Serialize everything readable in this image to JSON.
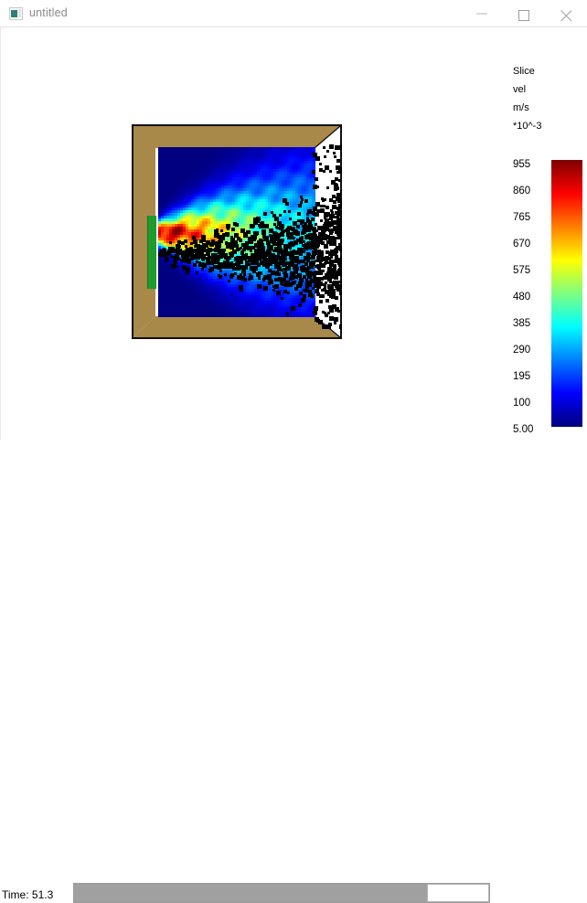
{
  "window": {
    "title": "untitled",
    "icon": "app-icon",
    "controls": {
      "minimize": "minimize",
      "maximize": "maximize",
      "close": "close"
    }
  },
  "legend": {
    "lines": [
      "Slice",
      "vel",
      "m/s",
      "*10^-3"
    ],
    "ticks": [
      "955",
      "860",
      "765",
      "670",
      "575",
      "480",
      "385",
      "290",
      "195",
      "100",
      "5.00"
    ],
    "colormap": "jet",
    "colors": [
      "#ff0000",
      "#ff7f00",
      "#ffff00",
      "#00ff00",
      "#00ffc0",
      "#00c0ff",
      "#0000ff"
    ]
  },
  "status": {
    "time_label": "Time: 51.3"
  },
  "scene": {
    "geometry_color": "#a8894a",
    "outline_color": "#000000",
    "vent_color": "#1f9a2e",
    "particle_color": "#000000",
    "background_color": "#ffffff"
  },
  "chart_data": {
    "type": "heatmap",
    "title": "Slice vel m/s *10^-3",
    "colormap": "jet",
    "colorbar_ticks": [
      955,
      860,
      765,
      670,
      575,
      480,
      385,
      290,
      195,
      100,
      5.0
    ],
    "value_range": [
      5.0,
      955
    ],
    "units": "m/s *10^-3",
    "quantity": "vel",
    "time": 51.3,
    "description": "Velocity magnitude slice through a jet issuing from a vent on the left wall of a rectangular enclosure, overlaid with black tracer particles",
    "field_profile": {
      "axis": "jet centerline is horizontal at mid-height",
      "core_values": [
        955,
        860,
        765
      ],
      "shear_values": [
        575,
        480,
        385
      ],
      "ambient_values": [
        100,
        5.0
      ]
    }
  }
}
